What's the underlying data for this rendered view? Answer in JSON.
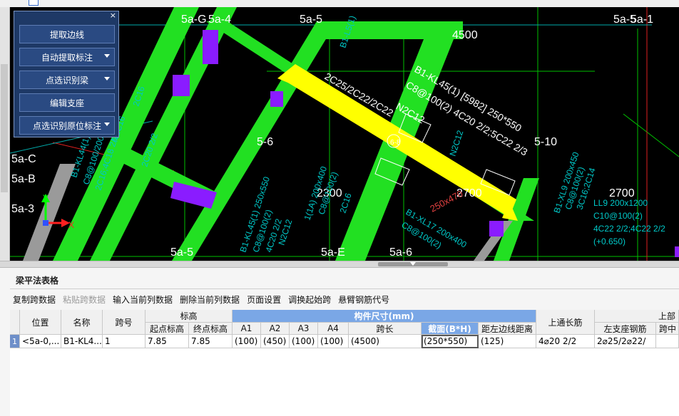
{
  "panel": {
    "close_label": "×",
    "buttons": [
      {
        "label": "提取边线",
        "dropdown": false
      },
      {
        "label": "自动提取标注",
        "dropdown": true
      },
      {
        "label": "点选识别梁",
        "dropdown": true
      },
      {
        "label": "编辑支座",
        "dropdown": false
      },
      {
        "label": "点选识别原位标注",
        "dropdown": true
      }
    ]
  },
  "canvas": {
    "labels": {
      "g1": "5a-G",
      "g2": "5a-4",
      "g3": "5a-5",
      "g4": "5a-5",
      "g5": "5a-1",
      "g6": "5a-C",
      "g7": "5a-B",
      "g8": "5a-3",
      "g9": "5a-5",
      "g10": "5a-E",
      "g11": "5a-6",
      "g12": "5-6",
      "g13": "5-10",
      "d1": "4500",
      "d2": "2300",
      "d3": "2700",
      "d4": "2700",
      "b1": "B1-KL45(1) [5982] 250*550",
      "b2": "C8@100(2) 4C20 2/2;5C22 2/3",
      "b3": "2C25/2C22/2C22",
      "b4": "N2C12",
      "b5": "B1-KL44(1) 200x400",
      "b6": "C8@100/200(2)",
      "b7": "2C16;4C18 2/2",
      "b8": "B1-KL45(1) 250x550",
      "b9": "C8@100(2)",
      "b10": "4C20 2/2",
      "b11": "N2C12",
      "b12": "B1-L5(1)",
      "b13": "B1-XL17 200x400",
      "b14": "C8@100(2)",
      "b15": "LL9 200x1200",
      "b16": "C10@100(2)",
      "b17": "4C22 2/2;4C22 2/2",
      "b18": "(+0.650)",
      "b19": "250x470",
      "b20": "N2C16",
      "b21": "2C16",
      "b22": "2C20 2/2",
      "b23": "1(1A) 200x400",
      "b24": "C8@100(2)",
      "b25": "2C16",
      "b26": "B1-XL9 200x450",
      "b27": "C8@100(2)",
      "b28": "3C16;2C14",
      "b29": "6-8",
      "b30": "N2C12",
      "axis_y": "Y",
      "axis_x": "X"
    }
  },
  "section": {
    "title": "梁平法表格"
  },
  "toolbar": {
    "items": [
      {
        "label": "复制跨数据",
        "enabled": true
      },
      {
        "label": "粘贴跨数据",
        "enabled": false
      },
      {
        "label": "输入当前列数据",
        "enabled": true
      },
      {
        "label": "删除当前列数据",
        "enabled": true
      },
      {
        "label": "页面设置",
        "enabled": true
      },
      {
        "label": "调换起始跨",
        "enabled": true
      },
      {
        "label": "悬臂钢筋代号",
        "enabled": true
      }
    ]
  },
  "table": {
    "headers": {
      "position": "位置",
      "name": "名称",
      "span": "跨号",
      "elevation": "标高",
      "start_elev": "起点标高",
      "end_elev": "终点标高",
      "component_size": "构件尺寸(mm)",
      "a1": "A1",
      "a2": "A2",
      "a3": "A3",
      "a4": "A4",
      "span_length": "跨长",
      "section": "截面(B*H)",
      "edge_dist": "距左边线距离",
      "top_through": "上通长筋",
      "top_group": "上部",
      "left_support": "左支座钢筋",
      "span_mid": "跨中"
    },
    "rows": [
      {
        "row_num": "1",
        "position": "<5a-0,...",
        "name": "B1-KL4...",
        "span": "1",
        "start_elev": "7.85",
        "end_elev": "7.85",
        "a1": "(100)",
        "a2": "(450)",
        "a3": "(100)",
        "a4": "(100)",
        "span_length": "(4500)",
        "section": "(250*550)",
        "edge_dist": "(125)",
        "top_through": "4⌀20 2/2",
        "left_support": "2⌀25/2⌀22/"
      }
    ]
  },
  "colors": {
    "beam_green": "#22e022",
    "beam_yellow": "#ffff00",
    "support_purple": "#8a1cff",
    "grid_line": "#00d000",
    "annotation": "#00c8c8",
    "panel_bg": "#1e3966",
    "header_blue": "#7aa7e6"
  }
}
